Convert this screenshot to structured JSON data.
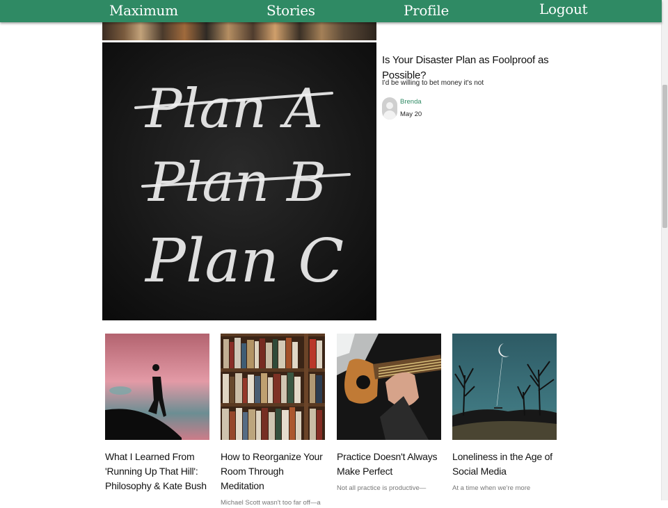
{
  "nav": {
    "brand": "Maximum",
    "stories": "Stories",
    "profile": "Profile",
    "logout": "Logout"
  },
  "featured": {
    "title": "Is Your Disaster Plan as Foolproof as Possible?",
    "subtitle": "I'd be willing to bet money it's not",
    "author": "Brenda",
    "date": "May 20",
    "chalk_lines": [
      "Plan A",
      "Plan B",
      "Plan C"
    ]
  },
  "cards": [
    {
      "title": "What I Learned From 'Running Up That Hill': Philosophy & Kate Bush",
      "excerpt": ""
    },
    {
      "title": "How to Reorganize Your Room Through Meditation",
      "excerpt": "Michael Scott wasn't too far off—a clean"
    },
    {
      "title": "Practice Doesn't Always Make Perfect",
      "excerpt": "Not all practice is productive—here's how"
    },
    {
      "title": "Loneliness in the Age of Social Media",
      "excerpt": "At a time when we're more connected"
    }
  ],
  "colors": {
    "nav_bg": "#2f8a64",
    "author_link": "#2f8a64"
  }
}
